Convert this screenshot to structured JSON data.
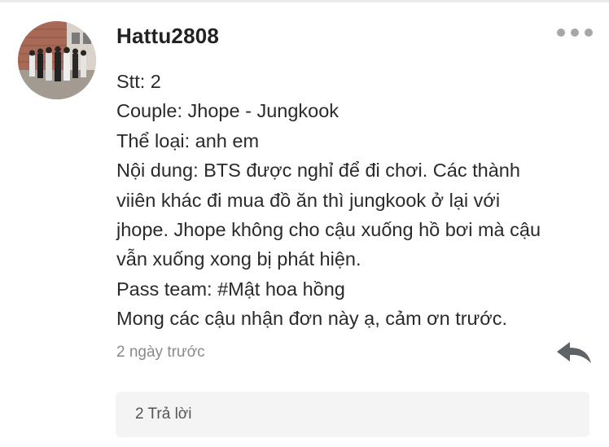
{
  "comment": {
    "username": "Hattu2808",
    "avatar_icon": "group-photo-avatar",
    "more_icon": "more-horizontal-icon",
    "lines": [
      "Stt: 2",
      "Couple: Jhope - Jungkook",
      "Thể loại: anh em",
      "Nội dung: BTS được nghỉ để đi chơi. Các thành",
      "viiên khác đi mua đồ ăn thì jungkook ở lại với",
      "jhope. Jhope không cho cậu xuống hồ bơi mà cậu",
      "vẫn xuống xong bị phát hiện.",
      "Pass team:  #Mật hoa hồng",
      "Mong các cậu nhận đơn này ạ, cảm ơn trước."
    ],
    "timestamp": "2 ngày trước",
    "reply_icon": "reply-arrow-icon",
    "replies_label": "2 Trả lời"
  },
  "colors": {
    "text": "#2a2a2a",
    "muted": "#8a8a8a",
    "icon": "#5f6368",
    "reply_box": "#f4f4f4"
  }
}
